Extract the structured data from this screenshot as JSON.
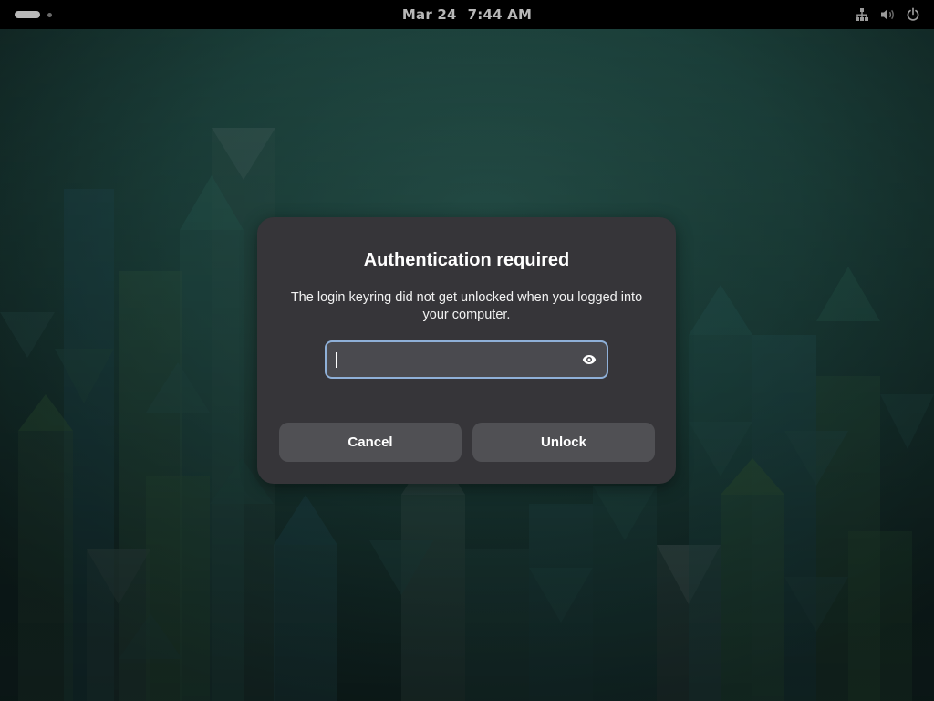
{
  "topbar": {
    "date": "Mar 24",
    "time": "7:44 AM",
    "icons": [
      "activities-indicator",
      "network-icon",
      "volume-icon",
      "power-icon"
    ]
  },
  "dialog": {
    "title": "Authentication required",
    "description": "The login keyring did not get unlocked when you logged into your computer.",
    "password": {
      "value": "",
      "placeholder": "",
      "reveal_icon": "eye-icon"
    },
    "cancel_label": "Cancel",
    "unlock_label": "Unlock"
  },
  "colors": {
    "dialog_bg": "#363539",
    "button_bg": "#505054",
    "focus_ring": "#8fb0d8",
    "topbar_bg": "#000000"
  }
}
